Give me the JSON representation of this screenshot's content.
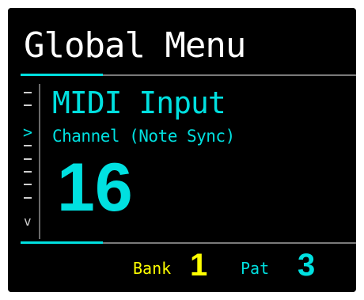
{
  "header": {
    "title": "Global Menu"
  },
  "menu": {
    "label": "MIDI Input",
    "sublabel": "Channel (Note Sync)",
    "value": "16"
  },
  "scrollbar": {
    "cursor_glyph": ">",
    "more_glyph": "v"
  },
  "footer": {
    "bank_label": "Bank",
    "bank_value": "1",
    "pat_label": "Pat",
    "pat_value": "3"
  },
  "colors": {
    "background": "#000000",
    "accent": "#00e0e0",
    "bank": "#ffff00",
    "title": "#ffffff"
  }
}
